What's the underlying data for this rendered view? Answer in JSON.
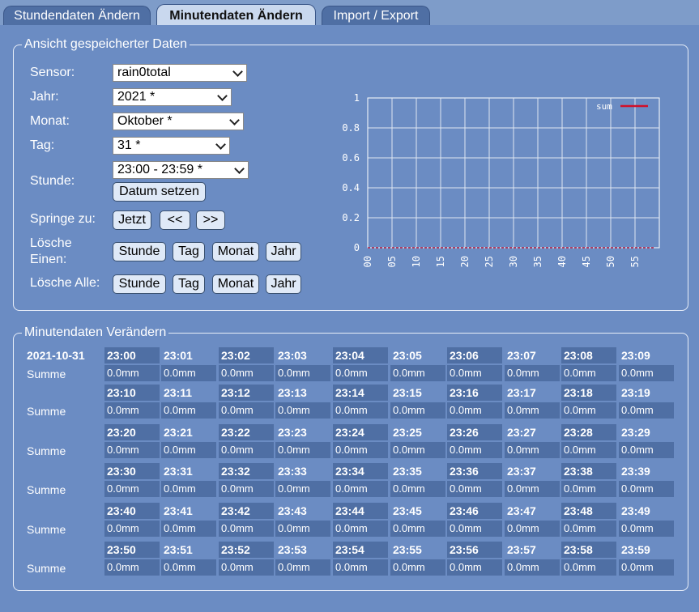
{
  "tabs": [
    {
      "label": "Stundendaten Ändern",
      "active": false
    },
    {
      "label": "Minutendaten Ändern",
      "active": true
    },
    {
      "label": "Import / Export",
      "active": false
    }
  ],
  "view": {
    "legend": "Ansicht gespeicherter Daten",
    "sensor_label": "Sensor:",
    "sensor_value": "rain0total",
    "year_label": "Jahr:",
    "year_value": "2021 *",
    "month_label": "Monat:",
    "month_value": "Oktober *",
    "day_label": "Tag:",
    "day_value": "31 *",
    "hour_label": "Stunde:",
    "hour_value": "23:00 - 23:59 *",
    "set_date_button": "Datum setzen",
    "jump_label": "Springe zu:",
    "jump_now": "Jetzt",
    "jump_prev": "<<",
    "jump_next": ">>",
    "delete_one_label_line1": "Lösche",
    "delete_one_label_line2": "Einen:",
    "delete_all_label": "Lösche Alle:",
    "btn_hour": "Stunde",
    "btn_day": "Tag",
    "btn_month": "Monat",
    "btn_year": "Jahr"
  },
  "chart_data": {
    "type": "line",
    "series": [
      {
        "name": "sum",
        "color": "#d0102a",
        "x": [
          0,
          5,
          10,
          15,
          20,
          25,
          30,
          35,
          40,
          45,
          50,
          55,
          59
        ],
        "values": [
          0,
          0,
          0,
          0,
          0,
          0,
          0,
          0,
          0,
          0,
          0,
          0,
          0
        ]
      }
    ],
    "x_tick_labels": [
      "00",
      "05",
      "10",
      "15",
      "20",
      "25",
      "30",
      "35",
      "40",
      "45",
      "50",
      "55"
    ],
    "y_tick_labels": [
      "0",
      "0.2",
      "0.4",
      "0.6",
      "0.8",
      "1"
    ],
    "ylim": [
      0,
      1
    ],
    "xlim": [
      0,
      60
    ],
    "grid": true,
    "legend_position": "top-right"
  },
  "minutes": {
    "legend": "Minutendaten Verändern",
    "date": "2021-10-31",
    "row_label": "Summe",
    "rows": [
      {
        "times": [
          "23:00",
          "23:01",
          "23:02",
          "23:03",
          "23:04",
          "23:05",
          "23:06",
          "23:07",
          "23:08",
          "23:09"
        ],
        "values": [
          "0.0mm",
          "0.0mm",
          "0.0mm",
          "0.0mm",
          "0.0mm",
          "0.0mm",
          "0.0mm",
          "0.0mm",
          "0.0mm",
          "0.0mm"
        ]
      },
      {
        "times": [
          "23:10",
          "23:11",
          "23:12",
          "23:13",
          "23:14",
          "23:15",
          "23:16",
          "23:17",
          "23:18",
          "23:19"
        ],
        "values": [
          "0.0mm",
          "0.0mm",
          "0.0mm",
          "0.0mm",
          "0.0mm",
          "0.0mm",
          "0.0mm",
          "0.0mm",
          "0.0mm",
          "0.0mm"
        ]
      },
      {
        "times": [
          "23:20",
          "23:21",
          "23:22",
          "23:23",
          "23:24",
          "23:25",
          "23:26",
          "23:27",
          "23:28",
          "23:29"
        ],
        "values": [
          "0.0mm",
          "0.0mm",
          "0.0mm",
          "0.0mm",
          "0.0mm",
          "0.0mm",
          "0.0mm",
          "0.0mm",
          "0.0mm",
          "0.0mm"
        ]
      },
      {
        "times": [
          "23:30",
          "23:31",
          "23:32",
          "23:33",
          "23:34",
          "23:35",
          "23:36",
          "23:37",
          "23:38",
          "23:39"
        ],
        "values": [
          "0.0mm",
          "0.0mm",
          "0.0mm",
          "0.0mm",
          "0.0mm",
          "0.0mm",
          "0.0mm",
          "0.0mm",
          "0.0mm",
          "0.0mm"
        ]
      },
      {
        "times": [
          "23:40",
          "23:41",
          "23:42",
          "23:43",
          "23:44",
          "23:45",
          "23:46",
          "23:47",
          "23:48",
          "23:49"
        ],
        "values": [
          "0.0mm",
          "0.0mm",
          "0.0mm",
          "0.0mm",
          "0.0mm",
          "0.0mm",
          "0.0mm",
          "0.0mm",
          "0.0mm",
          "0.0mm"
        ]
      },
      {
        "times": [
          "23:50",
          "23:51",
          "23:52",
          "23:53",
          "23:54",
          "23:55",
          "23:56",
          "23:57",
          "23:58",
          "23:59"
        ],
        "values": [
          "0.0mm",
          "0.0mm",
          "0.0mm",
          "0.0mm",
          "0.0mm",
          "0.0mm",
          "0.0mm",
          "0.0mm",
          "0.0mm",
          "0.0mm"
        ]
      }
    ]
  },
  "colors": {
    "page_bg": "#6b8cc3",
    "cell_bg": "#4f6fa4",
    "tab_active": "#c9d8ee",
    "series_line": "#d0102a"
  }
}
